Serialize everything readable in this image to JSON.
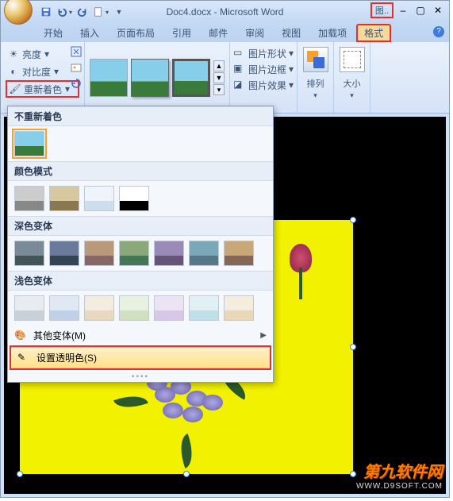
{
  "app_title": "Doc4.docx - Microsoft Word",
  "pic_tools_label": "图..",
  "tabs": {
    "home": "开始",
    "insert": "插入",
    "layout": "页面布局",
    "references": "引用",
    "mailings": "邮件",
    "review": "审阅",
    "view": "视图",
    "addins": "加载项",
    "format": "格式"
  },
  "ribbon": {
    "brightness": "亮度",
    "contrast": "对比度",
    "recolor": "重新着色",
    "pic_shape": "图片形状",
    "pic_border": "图片边框",
    "pic_effects": "图片效果",
    "arrange": "排列",
    "size": "大小"
  },
  "recolor_panel": {
    "no_recolor": "不重新着色",
    "color_modes": "颜色模式",
    "dark_variants": "深色变体",
    "light_variants": "浅色变体",
    "more_variants": "其他变体(M)",
    "set_transparent": "设置透明色(S)"
  },
  "watermark": {
    "line1": "第九软件网",
    "line2": "WWW.D9SOFT.COM"
  }
}
